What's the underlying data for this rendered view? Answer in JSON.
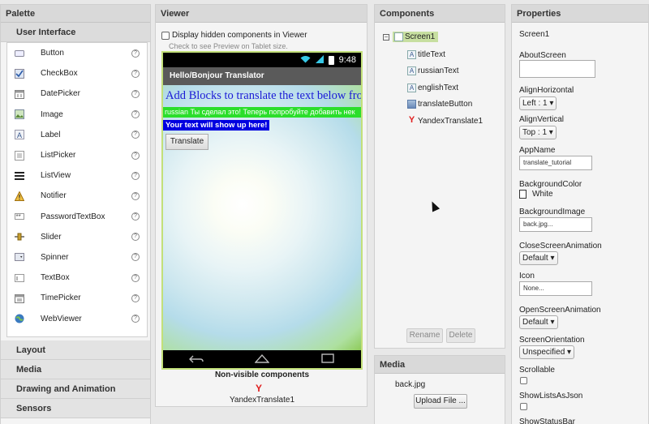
{
  "palette": {
    "title": "Palette",
    "category_open": "User Interface",
    "items": [
      {
        "label": "Button",
        "icon": "button-icon"
      },
      {
        "label": "CheckBox",
        "icon": "checkbox-icon"
      },
      {
        "label": "DatePicker",
        "icon": "datepicker-icon"
      },
      {
        "label": "Image",
        "icon": "image-icon"
      },
      {
        "label": "Label",
        "icon": "label-icon"
      },
      {
        "label": "ListPicker",
        "icon": "listpicker-icon"
      },
      {
        "label": "ListView",
        "icon": "listview-icon"
      },
      {
        "label": "Notifier",
        "icon": "notifier-icon"
      },
      {
        "label": "PasswordTextBox",
        "icon": "password-icon"
      },
      {
        "label": "Slider",
        "icon": "slider-icon"
      },
      {
        "label": "Spinner",
        "icon": "spinner-icon"
      },
      {
        "label": "TextBox",
        "icon": "textbox-icon"
      },
      {
        "label": "TimePicker",
        "icon": "timepicker-icon"
      },
      {
        "label": "WebViewer",
        "icon": "webviewer-icon"
      }
    ],
    "categories_closed": [
      "Layout",
      "Media",
      "Drawing and Animation",
      "Sensors"
    ]
  },
  "viewer": {
    "title": "Viewer",
    "hidden_checkbox_label": "Display hidden components in Viewer",
    "tablet_hint": "Check to see Preview on Tablet size.",
    "status_time": "9:48",
    "app_title": "Hello/Bonjour Translator",
    "title_text": "Add Blocks to translate the text below from",
    "russian_text": "russian Ты сделал это! Теперь попробуйте добавить нек",
    "english_text": "Your text will show up here!",
    "translate_button": "Translate",
    "nonvisible_title": "Non-visible components",
    "nonvisible_item": "YandexTranslate1"
  },
  "components": {
    "title": "Components",
    "screen": "Screen1",
    "children": [
      "titleText",
      "russianText",
      "englishText",
      "translateButton",
      "YandexTranslate1"
    ],
    "rename_button": "Rename",
    "delete_button": "Delete"
  },
  "media": {
    "title": "Media",
    "file": "back.jpg",
    "upload_button": "Upload File ..."
  },
  "properties": {
    "title": "Properties",
    "component": "Screen1",
    "about_label": "AboutScreen",
    "align_h_label": "AlignHorizontal",
    "align_h_value": "Left : 1",
    "align_v_label": "AlignVertical",
    "align_v_value": "Top : 1",
    "appname_label": "AppName",
    "appname_value": "translate_tutorial",
    "bgcolor_label": "BackgroundColor",
    "bgcolor_value": "White",
    "bgimage_label": "BackgroundImage",
    "bgimage_value": "back.jpg...",
    "close_anim_label": "CloseScreenAnimation",
    "close_anim_value": "Default",
    "icon_label": "Icon",
    "icon_value": "None...",
    "open_anim_label": "OpenScreenAnimation",
    "open_anim_value": "Default",
    "orientation_label": "ScreenOrientation",
    "orientation_value": "Unspecified",
    "scrollable_label": "Scrollable",
    "showlists_label": "ShowListsAsJson",
    "statusbar_label": "ShowStatusBar"
  },
  "colors": {
    "accent_green": "#c7dfa0",
    "title_blue": "#1a1ad6",
    "russian_bg": "#2bde2b",
    "english_bg": "#0000e0",
    "yandex_red": "#e02020"
  }
}
